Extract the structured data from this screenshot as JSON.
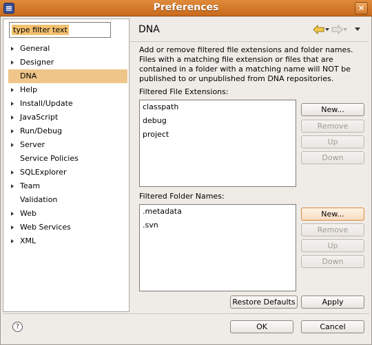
{
  "window": {
    "title": "Preferences"
  },
  "filter": {
    "placeholder": "type filter text"
  },
  "tree": {
    "items": [
      {
        "label": "General",
        "expandable": true
      },
      {
        "label": "Designer",
        "expandable": true
      },
      {
        "label": "DNA",
        "expandable": false,
        "selected": true
      },
      {
        "label": "Help",
        "expandable": true
      },
      {
        "label": "Install/Update",
        "expandable": true
      },
      {
        "label": "JavaScript",
        "expandable": true
      },
      {
        "label": "Run/Debug",
        "expandable": true
      },
      {
        "label": "Server",
        "expandable": true
      },
      {
        "label": "Service Policies",
        "expandable": false
      },
      {
        "label": "SQLExplorer",
        "expandable": true
      },
      {
        "label": "Team",
        "expandable": true
      },
      {
        "label": "Validation",
        "expandable": false
      },
      {
        "label": "Web",
        "expandable": true
      },
      {
        "label": "Web Services",
        "expandable": true
      },
      {
        "label": "XML",
        "expandable": true
      }
    ]
  },
  "page": {
    "title": "DNA",
    "description": "Add or remove filtered file extensions and folder names. Files with a matching file extension or files that are contained in a folder with a matching name will NOT be published to or unpublished from DNA repositories.",
    "file_ext_label": "Filtered File Extensions:",
    "file_extensions": [
      "classpath",
      "debug",
      "project"
    ],
    "folder_label": "Filtered Folder Names:",
    "folder_names": [
      ".metadata",
      ".svn"
    ]
  },
  "buttons": {
    "new": "New...",
    "remove": "Remove",
    "up": "Up",
    "down": "Down",
    "restore_defaults": "Restore Defaults",
    "apply": "Apply",
    "ok": "OK",
    "cancel": "Cancel"
  },
  "icons": {
    "help": "?"
  }
}
